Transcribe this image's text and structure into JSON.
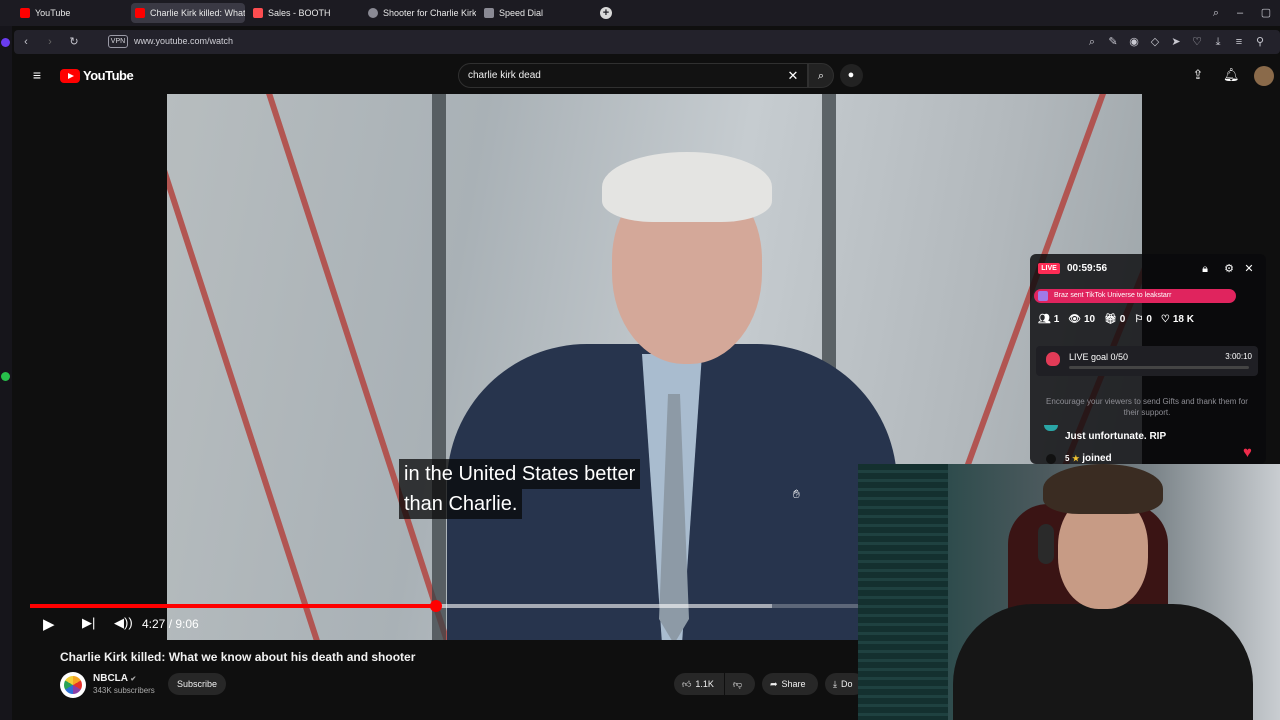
{
  "browser": {
    "tabs": [
      {
        "label": "YouTube",
        "favicon_color": "#ff0000",
        "active": false
      },
      {
        "label": "Charlie Kirk killed: What w",
        "favicon_color": "#ff0000",
        "active": true
      },
      {
        "label": "Sales - BOOTH",
        "favicon_color": "#fc4d50",
        "active": false
      },
      {
        "label": "Shooter for Charlie Kirk",
        "favicon_color": "#8a8a94",
        "active": false
      },
      {
        "label": "Speed Dial",
        "favicon_color": "#8a8a94",
        "active": false
      }
    ],
    "vpn_label": "VPN",
    "url": "www.youtube.com/watch"
  },
  "youtube": {
    "logo_text": "YouTube",
    "search_query": "charlie kirk dead"
  },
  "player": {
    "captions": [
      "in the United States better",
      "than Charlie."
    ],
    "current_time": "4:27",
    "duration": "9:06",
    "time_display": "4:27 / 9:06",
    "played_fraction": 0.49,
    "loaded_fraction": 0.896
  },
  "video_info": {
    "title": "Charlie Kirk killed: What we know about his death and shooter",
    "channel": "NBCLA",
    "verified_mark": "✔",
    "subscribers": "343K subscribers",
    "subscribe_label": "Subscribe",
    "likes": "1.1K",
    "share_label": "Share",
    "download_label": "Do"
  },
  "live_overlay": {
    "badge": "LIVE",
    "timer": "00:59:56",
    "gift_banner": "Braz sent TikTok Universe to leakstarr",
    "stats": {
      "viewers": "1",
      "views": "10",
      "gifts": "0",
      "shares": "0",
      "likes": "18 K"
    },
    "goal_label": "LIVE goal 0/50",
    "goal_time": "3:00:10",
    "encourage_text": "Encourage your viewers to send Gifts and thank them for their support.",
    "comment": "Just unfortunate. RIP",
    "joined_level": "5",
    "joined_text": "joined"
  }
}
